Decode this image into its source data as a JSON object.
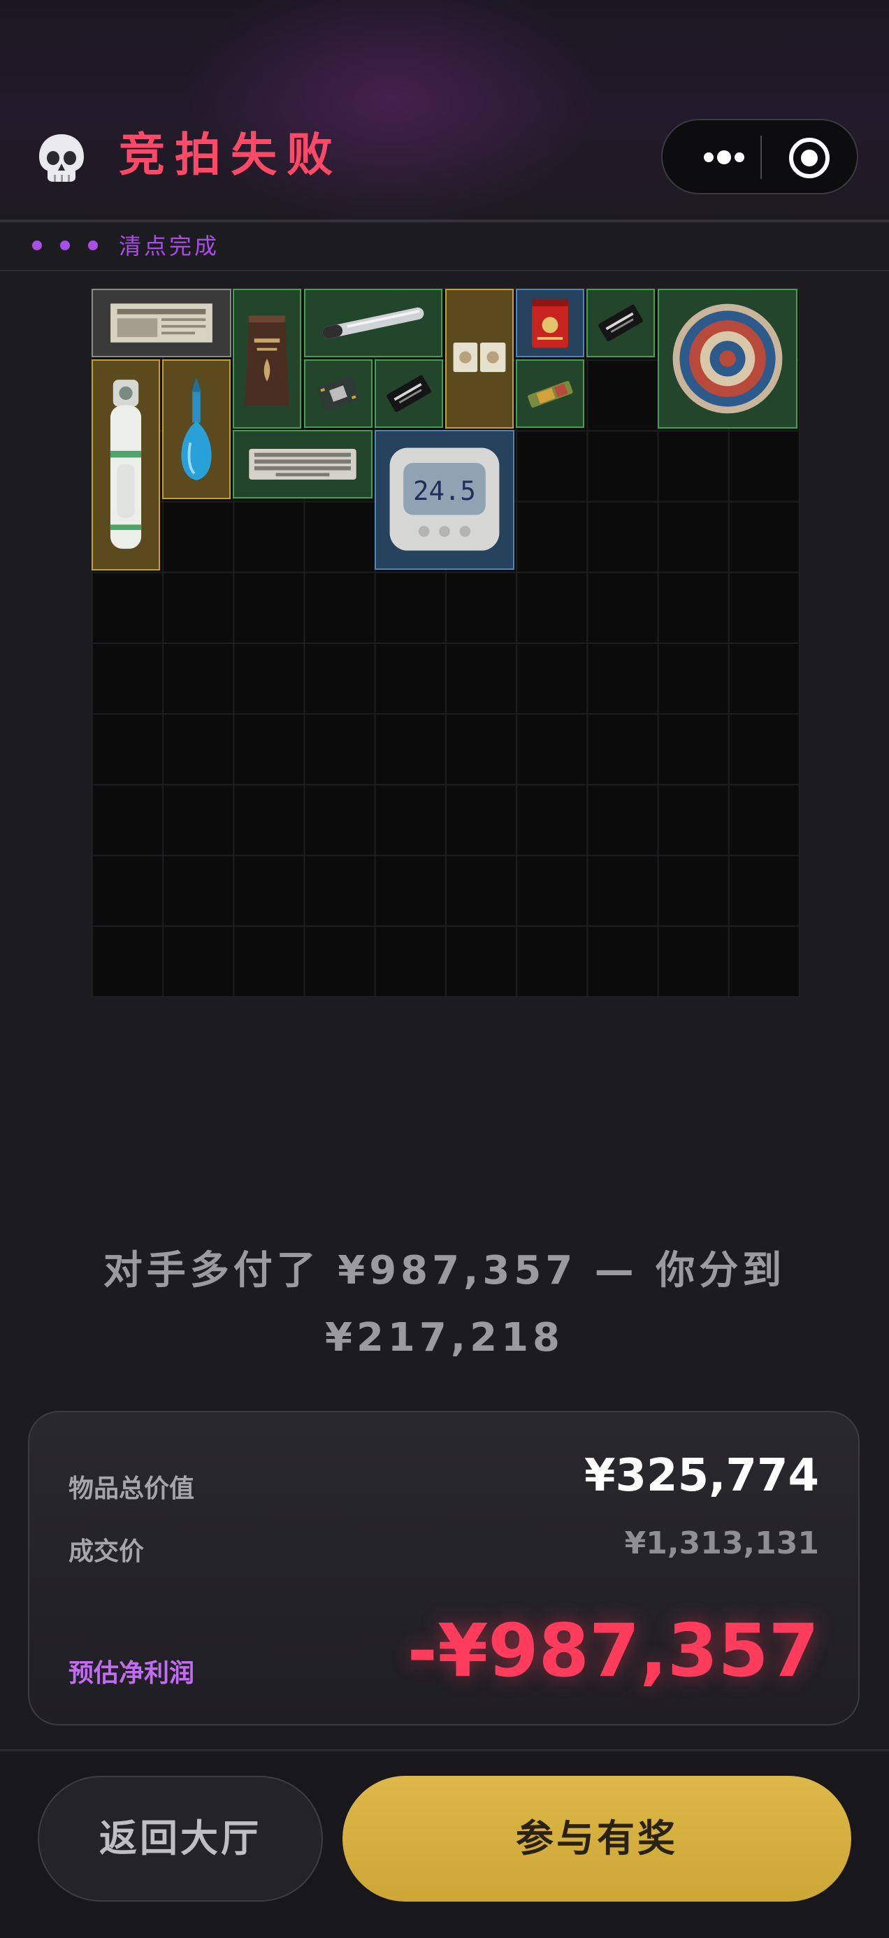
{
  "header": {
    "title": "竞拍失败",
    "icon": "skull-icon",
    "capsule": {
      "more": "more-dots-icon",
      "close": "target-close-icon"
    }
  },
  "status": {
    "text": "清点完成",
    "dot_color": "#a84ee6"
  },
  "inventory": {
    "columns": 10,
    "rows": 10,
    "items": [
      {
        "name": "newspaper",
        "rarity": "grey"
      },
      {
        "name": "coffee-bag",
        "rarity": "green"
      },
      {
        "name": "tube-rod",
        "rarity": "green"
      },
      {
        "name": "cards",
        "rarity": "gold"
      },
      {
        "name": "tea-tin",
        "rarity": "blue"
      },
      {
        "name": "good-luck-card",
        "rarity": "green"
      },
      {
        "name": "decorative-plate",
        "rarity": "green"
      },
      {
        "name": "oxygen-cylinder",
        "rarity": "gold"
      },
      {
        "name": "blue-perfume-bottle",
        "rarity": "gold"
      },
      {
        "name": "circuit-chip",
        "rarity": "green"
      },
      {
        "name": "good-luck-card-2",
        "rarity": "green"
      },
      {
        "name": "snack-bar",
        "rarity": "green"
      },
      {
        "name": "keyboard",
        "rarity": "green"
      },
      {
        "name": "digital-thermometer",
        "rarity": "blue"
      }
    ],
    "thermometer_reading": "24.5"
  },
  "message": "对手多付了 ¥987,357 — 你分到 ¥217,218",
  "summary": {
    "total_label": "物品总价值",
    "total_value": "¥325,774",
    "deal_label": "成交价",
    "deal_value": "¥1,313,131",
    "profit_label": "预估净利润",
    "profit_value": "-¥987,357"
  },
  "buttons": {
    "lobby": "返回大厅",
    "prize": "参与有奖"
  },
  "colors": {
    "title": "#ff4a67",
    "profit": "#ff3c5c",
    "profit_label": "#c26cf2",
    "prize_button": "#d4b03e"
  }
}
